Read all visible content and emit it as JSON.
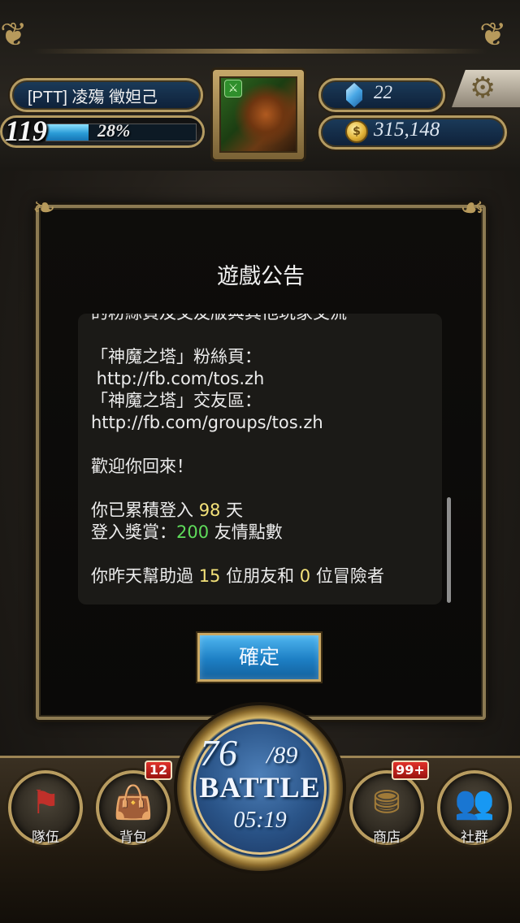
{
  "player": {
    "name": "[PTT] 凌殤 徵妲己",
    "level": "119",
    "exp_percent_label": "28%",
    "exp_fraction": 0.28
  },
  "currency": {
    "gems": "22",
    "coins": "315,148"
  },
  "dialog": {
    "title": "遊戲公告",
    "lines": [
      [
        {
          "t": "的粉絲頁及交友版與其他玩家交流"
        }
      ],
      [
        {
          "t": ""
        }
      ],
      [
        {
          "t": "「神魔之塔」粉絲頁："
        }
      ],
      [
        {
          "t": " http://fb.com/tos.zh"
        }
      ],
      [
        {
          "t": "「神魔之塔」交友區："
        }
      ],
      [
        {
          "t": "http://fb.com/groups/tos.zh"
        }
      ],
      [
        {
          "t": ""
        }
      ],
      [
        {
          "t": "歡迎你回來！"
        }
      ],
      [
        {
          "t": ""
        }
      ],
      [
        {
          "t": "你已累積登入 "
        },
        {
          "t": "98",
          "c": "y"
        },
        {
          "t": " 天"
        }
      ],
      [
        {
          "t": "登入獎賞："
        },
        {
          "t": "200",
          "c": "g"
        },
        {
          "t": " 友情點數"
        }
      ],
      [
        {
          "t": ""
        }
      ],
      [
        {
          "t": "你昨天幫助過 "
        },
        {
          "t": "15",
          "c": "y"
        },
        {
          "t": " 位朋友和 "
        },
        {
          "t": "0",
          "c": "y"
        },
        {
          "t": " 位冒險者"
        }
      ]
    ],
    "confirm_label": "確定"
  },
  "nav": {
    "team_label": "隊伍",
    "bag_label": "背包",
    "bag_badge": "12",
    "shop_label": "商店",
    "shop_badge": "99+",
    "social_label": "社群"
  },
  "battle": {
    "stamina_current": "76",
    "stamina_max": "/89",
    "label": "BATTLE",
    "timer": "05:19"
  },
  "colors": {
    "highlight_yellow": "#f4e27a",
    "highlight_green": "#5fdc5b",
    "frame_gold": "#b49b62",
    "button_blue": "#1d7fc4"
  }
}
